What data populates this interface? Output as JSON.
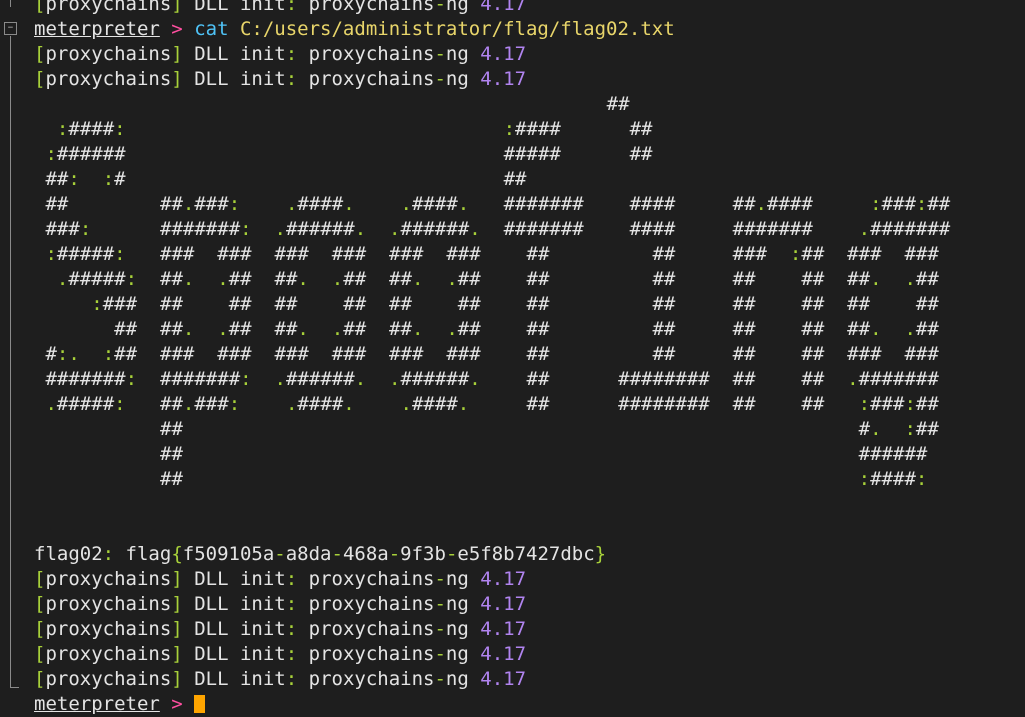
{
  "colors": {
    "background": "#1e1e1e",
    "bracket": "#a8d13a",
    "version": "#b184f0",
    "prompt_arrow": "#ff4fa0",
    "command": "#4fc3f7",
    "path": "#e8d56a",
    "cursor": "#ffa500"
  },
  "proxy": {
    "tag": "proxychains",
    "text1": "DLL init",
    "text2": "proxychains",
    "text3": "ng",
    "version": "4.17"
  },
  "prompt": {
    "name": "meterpreter",
    "arrow": ">",
    "command": "cat",
    "path": "C:/users/administrator/flag/flag02.txt"
  },
  "ascii_art": [
    "                                                  ##",
    "  :####:                                 :####      ##",
    " :######                                 #####      ##",
    " ##:  :#                                 ##",
    " ##        ##.###:    .####.    .####.   #######    ####     ##.####     :###:##",
    " ###:      #######:  .######.  .######.  #######    ####     #######    .#######",
    " :#####:   ###  ###  ###  ###  ###  ###    ##         ##     ###  :##  ###  ###",
    "  .#####:  ##.  .##  ##.  .##  ##.  .##    ##         ##     ##    ##  ##.  .##",
    "     :###  ##    ##  ##    ##  ##    ##    ##         ##     ##    ##  ##    ##",
    "       ##  ##.  .##  ##.  .##  ##.  .##    ##         ##     ##    ##  ##.  .##",
    " #:.  :##  ###  ###  ###  ###  ###  ###    ##         ##     ##    ##  ###  ###",
    " #######:  #######:  .######.  .######.    ##      ########  ##    ##  .#######",
    " .#####:   ##.###:    .####.    .####.     ##      ########  ##    ##   :###:##",
    "           ##                                                           #.  :##",
    "           ##                                                           ######",
    "           ##                                                           :####:",
    "",
    ""
  ],
  "flag": {
    "label": "flag02",
    "prefix": "flag",
    "open": "{",
    "parts": [
      "f509105a",
      "a8da",
      "468a",
      "9f3b",
      "e5f8b7427dbc"
    ],
    "close": "}"
  }
}
